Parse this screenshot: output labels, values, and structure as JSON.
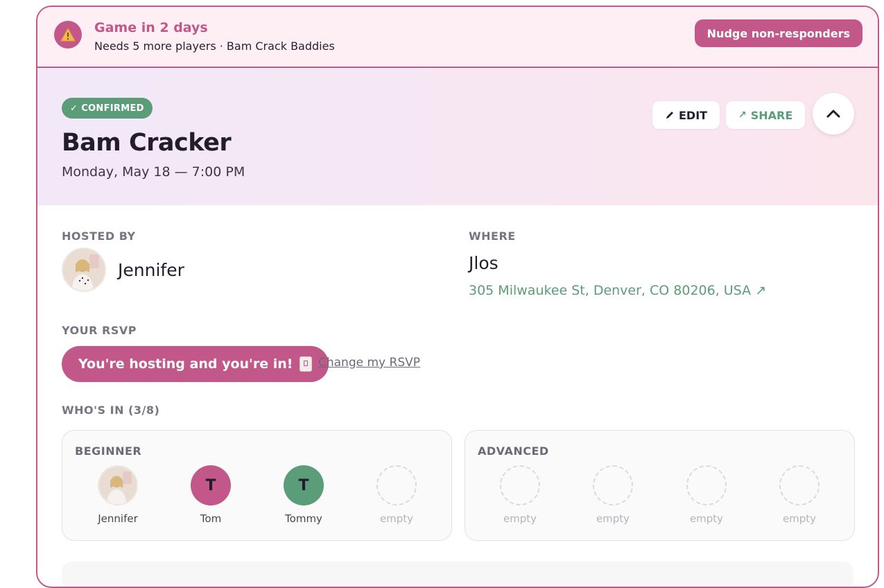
{
  "alert": {
    "title": "Game in 2 days",
    "subtitle": "Needs 5 more players · Bam Crack Baddies",
    "nudge_label": "Nudge non-responders",
    "icon": "warning-icon"
  },
  "event": {
    "status": "CONFIRMED",
    "title": "Bam Cracker",
    "date": "Monday, May 18 — 7:00 PM",
    "edit_label": "EDIT",
    "share_label": "SHARE"
  },
  "host": {
    "label": "HOSTED BY",
    "name": "Jennifer"
  },
  "where": {
    "label": "WHERE",
    "venue": "Jlos",
    "address": "305 Milwaukee St, Denver, CO 80206, USA ↗"
  },
  "rsvp": {
    "label": "YOUR RSVP",
    "status": "You're hosting and you're in!",
    "change_label": "Change my RSVP"
  },
  "whos_in": {
    "label": "WHO'S IN (3/8)",
    "groups": [
      {
        "name": "BEGINNER",
        "slots": [
          {
            "name": "Jennifer",
            "initial": "",
            "type": "avatar"
          },
          {
            "name": "Tom",
            "initial": "T",
            "type": "filled",
            "color": "#c2578a"
          },
          {
            "name": "Tommy",
            "initial": "T",
            "type": "filled",
            "color": "#5b9d78"
          },
          {
            "name": "empty",
            "initial": "",
            "type": "empty"
          }
        ]
      },
      {
        "name": "ADVANCED",
        "slots": [
          {
            "name": "empty",
            "initial": "",
            "type": "empty"
          },
          {
            "name": "empty",
            "initial": "",
            "type": "empty"
          },
          {
            "name": "empty",
            "initial": "",
            "type": "empty"
          },
          {
            "name": "empty",
            "initial": "",
            "type": "empty"
          }
        ]
      }
    ]
  },
  "colors": {
    "accent": "#c2578a",
    "success": "#5b9d78"
  }
}
